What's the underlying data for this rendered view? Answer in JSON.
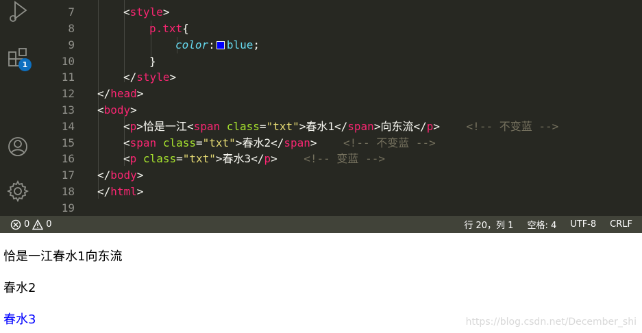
{
  "editor": {
    "lines": [
      {
        "num": "7",
        "tokens": [
          [
            "t-punct",
            "<"
          ],
          [
            "t-tag",
            "style"
          ],
          [
            "t-punct",
            ">"
          ]
        ]
      },
      {
        "num": "8",
        "tokens": [
          [
            "t-sel",
            "p.txt"
          ],
          [
            "t-punct",
            "{"
          ]
        ]
      },
      {
        "num": "9",
        "tokens": [
          [
            "t-prop",
            "color"
          ],
          [
            "t-punct",
            ":"
          ],
          [
            "swatch",
            ""
          ],
          [
            "t-val",
            "blue"
          ],
          [
            "t-punct",
            ";"
          ]
        ]
      },
      {
        "num": "10",
        "tokens": [
          [
            "t-punct",
            "}"
          ]
        ]
      },
      {
        "num": "11",
        "tokens": [
          [
            "t-punct",
            "</"
          ],
          [
            "t-tag",
            "style"
          ],
          [
            "t-punct",
            ">"
          ]
        ]
      },
      {
        "num": "12",
        "tokens": [
          [
            "t-punct",
            "</"
          ],
          [
            "t-tag",
            "head"
          ],
          [
            "t-punct",
            ">"
          ]
        ]
      },
      {
        "num": "13",
        "tokens": [
          [
            "t-punct",
            "<"
          ],
          [
            "t-tag",
            "body"
          ],
          [
            "t-punct",
            ">"
          ]
        ]
      },
      {
        "num": "14",
        "tokens": [
          [
            "t-punct",
            "<"
          ],
          [
            "t-tag",
            "p"
          ],
          [
            "t-punct",
            ">"
          ],
          [
            "t-text",
            "恰是一江"
          ],
          [
            "t-punct",
            "<"
          ],
          [
            "t-tag",
            "span"
          ],
          [
            "t-text",
            " "
          ],
          [
            "t-attr",
            "class"
          ],
          [
            "t-punct",
            "="
          ],
          [
            "t-str",
            "\"txt\""
          ],
          [
            "t-punct",
            ">"
          ],
          [
            "t-text",
            "春水1"
          ],
          [
            "t-punct",
            "</"
          ],
          [
            "t-tag",
            "span"
          ],
          [
            "t-punct",
            ">"
          ],
          [
            "t-text",
            "向东流"
          ],
          [
            "t-punct",
            "</"
          ],
          [
            "t-tag",
            "p"
          ],
          [
            "t-punct",
            ">"
          ],
          [
            "t-text",
            "    "
          ],
          [
            "t-comment",
            "<!-- 不变蓝 -->"
          ]
        ]
      },
      {
        "num": "15",
        "tokens": [
          [
            "t-punct",
            "<"
          ],
          [
            "t-tag",
            "span"
          ],
          [
            "t-text",
            " "
          ],
          [
            "t-attr",
            "class"
          ],
          [
            "t-punct",
            "="
          ],
          [
            "t-str",
            "\"txt\""
          ],
          [
            "t-punct",
            ">"
          ],
          [
            "t-text",
            "春水2"
          ],
          [
            "t-punct",
            "</"
          ],
          [
            "t-tag",
            "span"
          ],
          [
            "t-punct",
            ">"
          ],
          [
            "t-text",
            "    "
          ],
          [
            "t-comment",
            "<!-- 不变蓝 -->"
          ]
        ]
      },
      {
        "num": "16",
        "tokens": [
          [
            "t-punct",
            "<"
          ],
          [
            "t-tag",
            "p"
          ],
          [
            "t-text",
            " "
          ],
          [
            "t-attr",
            "class"
          ],
          [
            "t-punct",
            "="
          ],
          [
            "t-str",
            "\"txt\""
          ],
          [
            "t-punct",
            ">"
          ],
          [
            "t-text",
            "春水3"
          ],
          [
            "t-punct",
            "</"
          ],
          [
            "t-tag",
            "p"
          ],
          [
            "t-punct",
            ">"
          ],
          [
            "t-text",
            "    "
          ],
          [
            "t-comment",
            "<!-- 变蓝 -->"
          ]
        ]
      },
      {
        "num": "17",
        "tokens": [
          [
            "t-punct",
            "</"
          ],
          [
            "t-tag",
            "body"
          ],
          [
            "t-punct",
            ">"
          ]
        ]
      },
      {
        "num": "18",
        "tokens": [
          [
            "t-punct",
            "</"
          ],
          [
            "t-tag",
            "html"
          ],
          [
            "t-punct",
            ">"
          ]
        ]
      },
      {
        "num": "19",
        "tokens": []
      }
    ]
  },
  "activity": {
    "extensions_badge": "1",
    "icons": [
      "run-debug-icon",
      "extensions-icon",
      "account-icon",
      "gear-icon"
    ]
  },
  "status": {
    "errors": "0",
    "warnings": "0",
    "position": "行 20，列 1",
    "spaces": "空格: 4",
    "encoding": "UTF-8",
    "eol": "CRLF"
  },
  "preview": {
    "line1": "恰是一江春水1向东流",
    "line2": "春水2",
    "line3": "春水3",
    "line3_color": "#0000ff"
  },
  "watermark": "https://blog.csdn.net/December_shi",
  "colors": {
    "editor_bg": "#272822",
    "status_bg": "#414339",
    "tag": "#f92672",
    "attr": "#a6e22e",
    "string": "#e6db74",
    "comment": "#75715e",
    "keyword": "#66d9ef",
    "badge": "#0e70c0"
  }
}
